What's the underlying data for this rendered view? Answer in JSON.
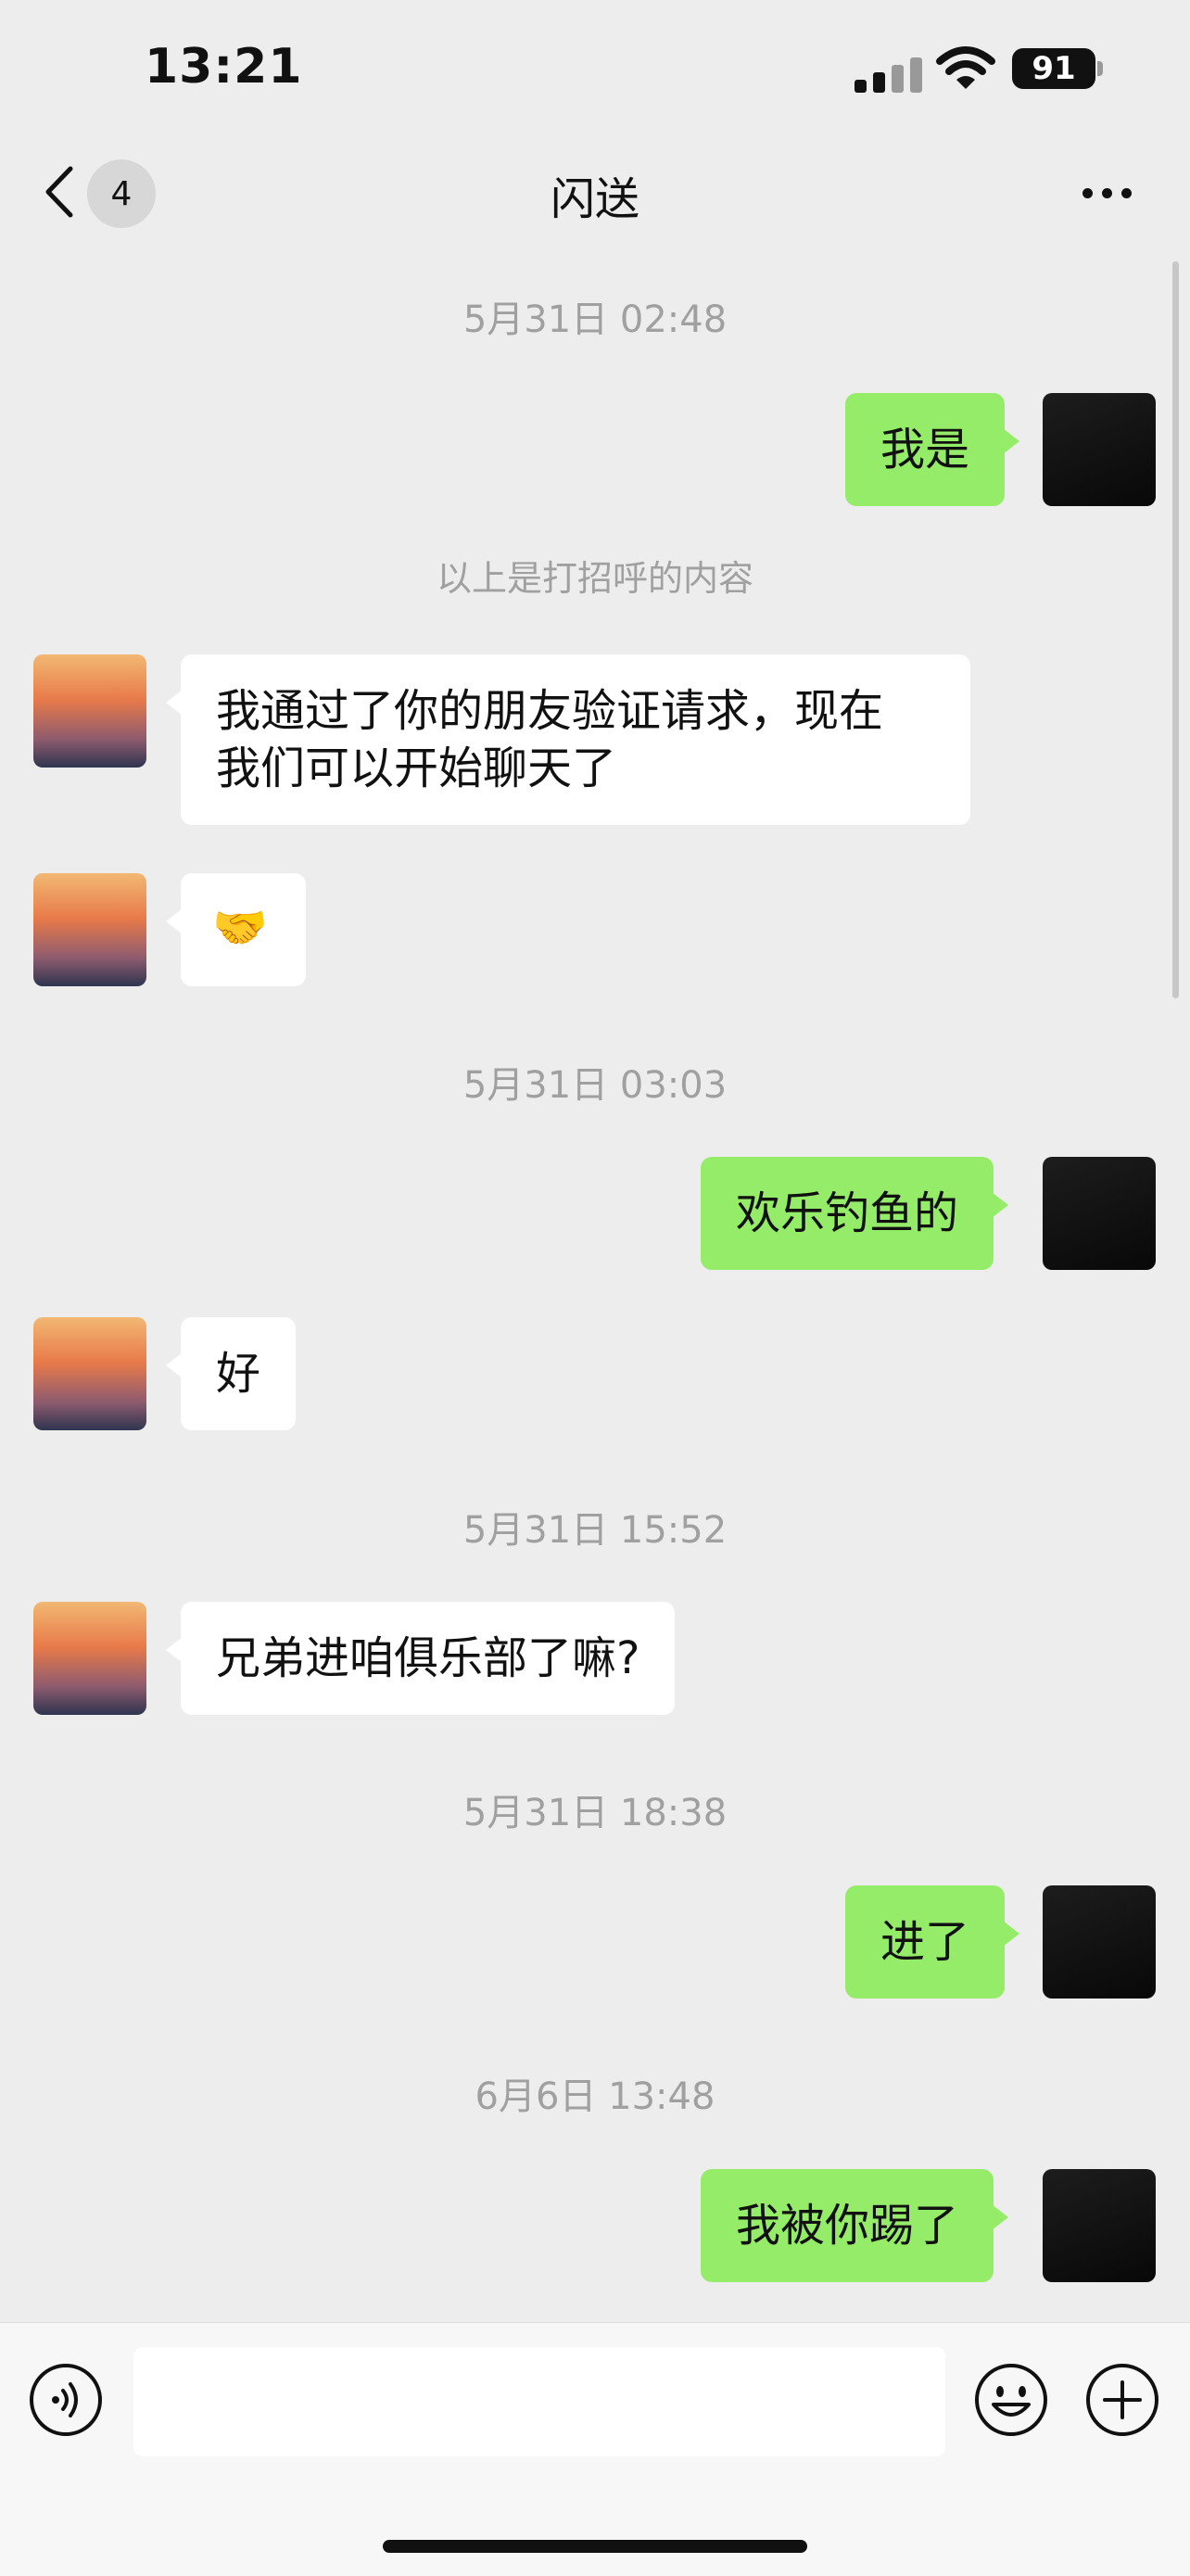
{
  "status_bar": {
    "time": "13:21",
    "battery": "91"
  },
  "nav": {
    "unread_count": "4",
    "title": "闪送"
  },
  "messages": {
    "ts1": "5月31日 02:48",
    "m1": "我是",
    "notice": "以上是打招呼的内容",
    "m2_line1": "我通过了你的朋友验证请求，现在",
    "m2_line2": "我们可以开始聊天了",
    "m3": "🤝",
    "ts2": "5月31日 03:03",
    "m4": "欢乐钓鱼的",
    "m5": "好",
    "ts3": "5月31日 15:52",
    "m6": "兄弟进咱俱乐部了嘛?",
    "ts4": "5月31日 18:38",
    "m7": "进了",
    "ts5": "6月6日 13:48",
    "m8": "我被你踢了"
  },
  "icons": {
    "back": "chevron-left-icon",
    "more": "more-dots-icon",
    "voice": "voice-icon",
    "emoji": "emoji-icon",
    "add": "plus-icon"
  },
  "colors": {
    "self_bubble": "#95ec69",
    "other_bubble": "#ffffff",
    "background": "#ededed"
  }
}
